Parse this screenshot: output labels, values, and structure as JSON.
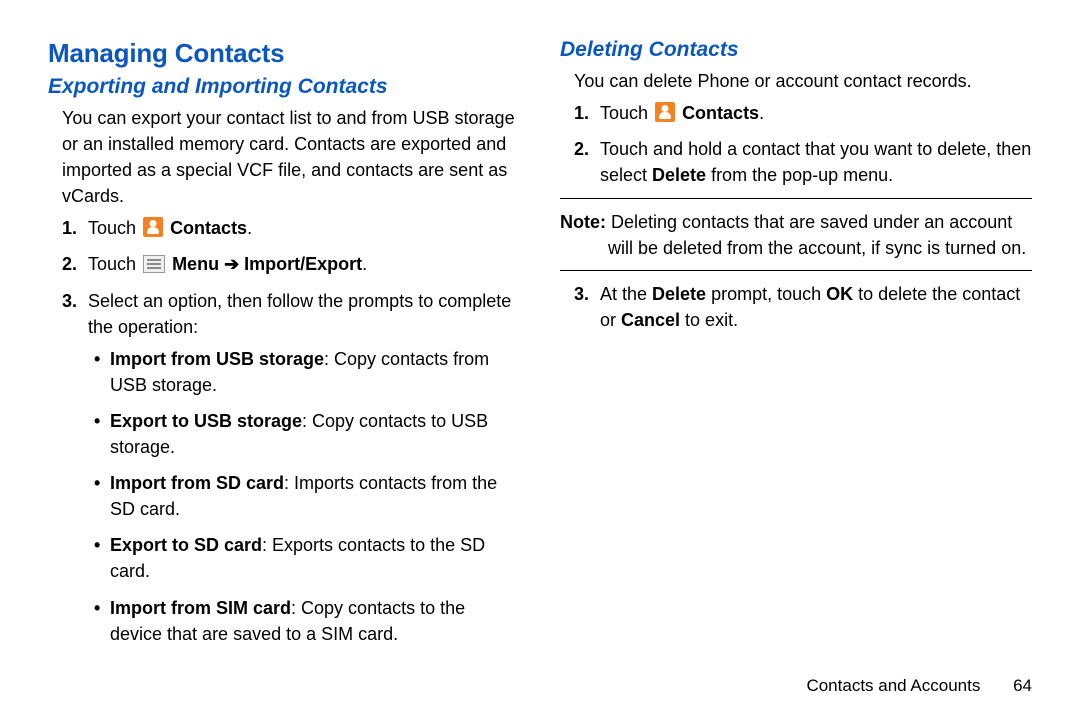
{
  "left": {
    "heading": "Managing Contacts",
    "subheading": "Exporting and Importing Contacts",
    "intro": "You can export your contact list to and from USB storage or an installed memory card. Contacts are exported and imported as a special VCF file, and contacts are sent as vCards.",
    "step1_pre": "Touch ",
    "step1_bold": "Contacts",
    "step1_post": ".",
    "step2_pre": "Touch ",
    "step2_menu": "Menu",
    "step2_arrow": " ➔ ",
    "step2_ie": "Import/Export",
    "step2_post": ".",
    "step3": "Select an option, then follow the prompts to complete the operation:",
    "b1_label": "Import from USB storage",
    "b1_text": ": Copy contacts from USB storage.",
    "b2_label": "Export to USB storage",
    "b2_text": ": Copy contacts to USB storage.",
    "b3_label": "Import from SD card",
    "b3_text": ": Imports contacts from the SD card.",
    "b4_label": "Export to SD card",
    "b4_text": ": Exports contacts to the SD card.",
    "b5_label": "Import from SIM card",
    "b5_text": ": Copy contacts to the device that are saved to a SIM card."
  },
  "right": {
    "subheading": "Deleting Contacts",
    "intro": "You can delete Phone or account contact records.",
    "step1_pre": "Touch ",
    "step1_bold": "Contacts",
    "step1_post": ".",
    "step2_a": "Touch and hold a contact that you want to delete, then select ",
    "step2_b": "Delete",
    "step2_c": " from the pop-up menu.",
    "note_label": "Note: ",
    "note_text": "Deleting contacts that are saved under an account will be deleted from the account, if sync is turned on.",
    "step3_a": "At the ",
    "step3_b": "Delete",
    "step3_c": " prompt, touch ",
    "step3_d": "OK",
    "step3_e": " to delete the contact or ",
    "step3_f": "Cancel",
    "step3_g": " to exit."
  },
  "footer": {
    "section": "Contacts and Accounts",
    "page": "64"
  }
}
